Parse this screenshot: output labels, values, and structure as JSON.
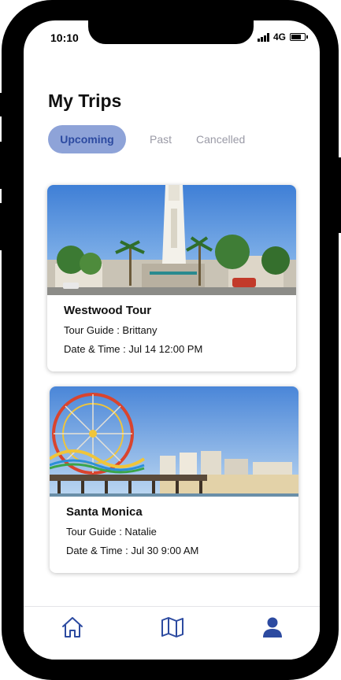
{
  "status_bar": {
    "time": "10:10",
    "network": "4G"
  },
  "page": {
    "title": "My Trips"
  },
  "tabs": [
    {
      "label": "Upcoming",
      "active": true
    },
    {
      "label": "Past",
      "active": false
    },
    {
      "label": "Cancelled",
      "active": false
    }
  ],
  "trips": [
    {
      "title": "Westwood Tour",
      "guide": "Tour Guide : Brittany",
      "datetime": "Date & Time : Jul 14  12:00 PM"
    },
    {
      "title": "Santa Monica",
      "guide": "Tour Guide : Natalie",
      "datetime": "Date & Time : Jul 30  9:00 AM"
    }
  ],
  "bottom_nav": [
    {
      "icon": "home-icon"
    },
    {
      "icon": "map-icon"
    },
    {
      "icon": "profile-icon",
      "active": true
    }
  ],
  "colors": {
    "accent": "#2c4aa0",
    "tab_active_bg": "#8ea3d8",
    "tab_inactive": "#9a9aa6"
  }
}
